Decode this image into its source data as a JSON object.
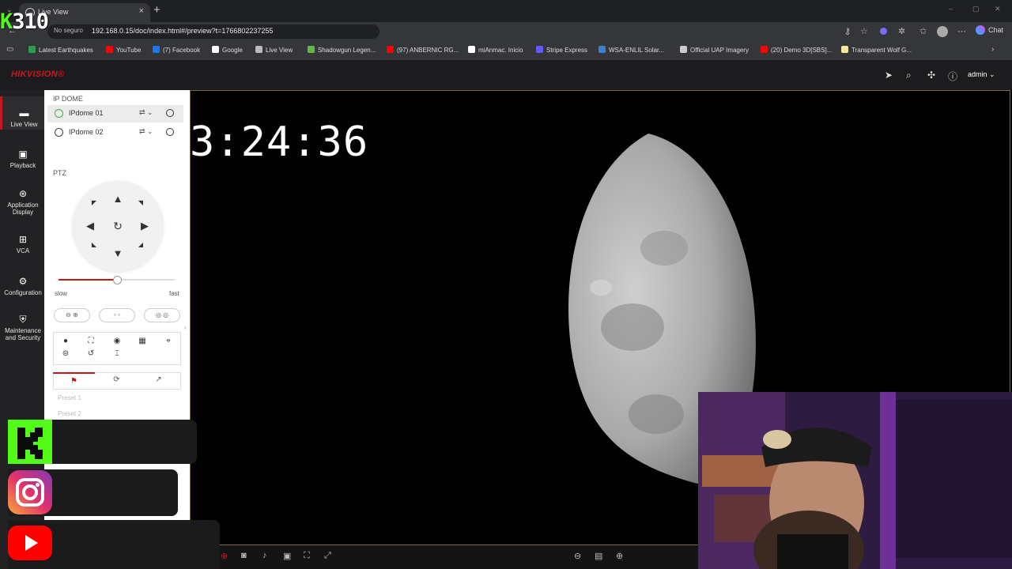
{
  "browser": {
    "tab_title": "Live View",
    "tab_close": "×",
    "new_tab": "+",
    "security_label": "No seguro",
    "url": "192.168.0.15/doc/index.html#/preview?t=1766802237255",
    "chat_label": "Chat",
    "window_controls": [
      "–",
      "▢",
      "✕"
    ]
  },
  "bookmarks": [
    {
      "label": "Latest Earthquakes",
      "color": "#2e9d4e"
    },
    {
      "label": "YouTube",
      "color": "#ff0000"
    },
    {
      "label": "(7) Facebook",
      "color": "#1877f2"
    },
    {
      "label": "Google",
      "color": "#ffffff"
    },
    {
      "label": "Live View",
      "color": "#bbbbbb"
    },
    {
      "label": "Shadowgun Legen...",
      "color": "#63b84a"
    },
    {
      "label": "(97) ANBERNIC RG...",
      "color": "#ff0000"
    },
    {
      "label": "miAnmac. Inicio",
      "color": "#ffffff"
    },
    {
      "label": "Stripe Express",
      "color": "#635bff"
    },
    {
      "label": "WSA-ENLIL Solar...",
      "color": "#3f7fd0"
    },
    {
      "label": "Official UAP Imagery",
      "color": "#cccccc"
    },
    {
      "label": "(20) Demo 3D[SBS]...",
      "color": "#ff0000"
    },
    {
      "label": "Transparent Wolf G...",
      "color": "#f5e6a0"
    }
  ],
  "overlay": {
    "stream_number": "310",
    "kick_letter": "K"
  },
  "app": {
    "brand": "HIKVISION®",
    "user": "admin",
    "accent": "#c9161b"
  },
  "nav": [
    {
      "label": "Live View",
      "icon": "monitor-icon"
    },
    {
      "label": "Playback",
      "icon": "playback-icon"
    },
    {
      "label": "Application Display",
      "icon": "application-icon"
    },
    {
      "label": "VCA",
      "icon": "vca-icon"
    },
    {
      "label": "Configuration",
      "icon": "gear-icon"
    },
    {
      "label": "Maintenance and Security",
      "icon": "shield-icon"
    }
  ],
  "panel": {
    "group_title": "IP DOME",
    "cameras": [
      {
        "name": "IPdome 01",
        "selected": true
      },
      {
        "name": "IPdome 02",
        "selected": false
      }
    ],
    "ptz_title": "PTZ",
    "speed_min": "slow",
    "speed_max": "fast",
    "speed_level": 0.5,
    "presets": [
      "Preset 1",
      "Preset 2"
    ]
  },
  "video": {
    "clock_text": "3:24:36"
  }
}
